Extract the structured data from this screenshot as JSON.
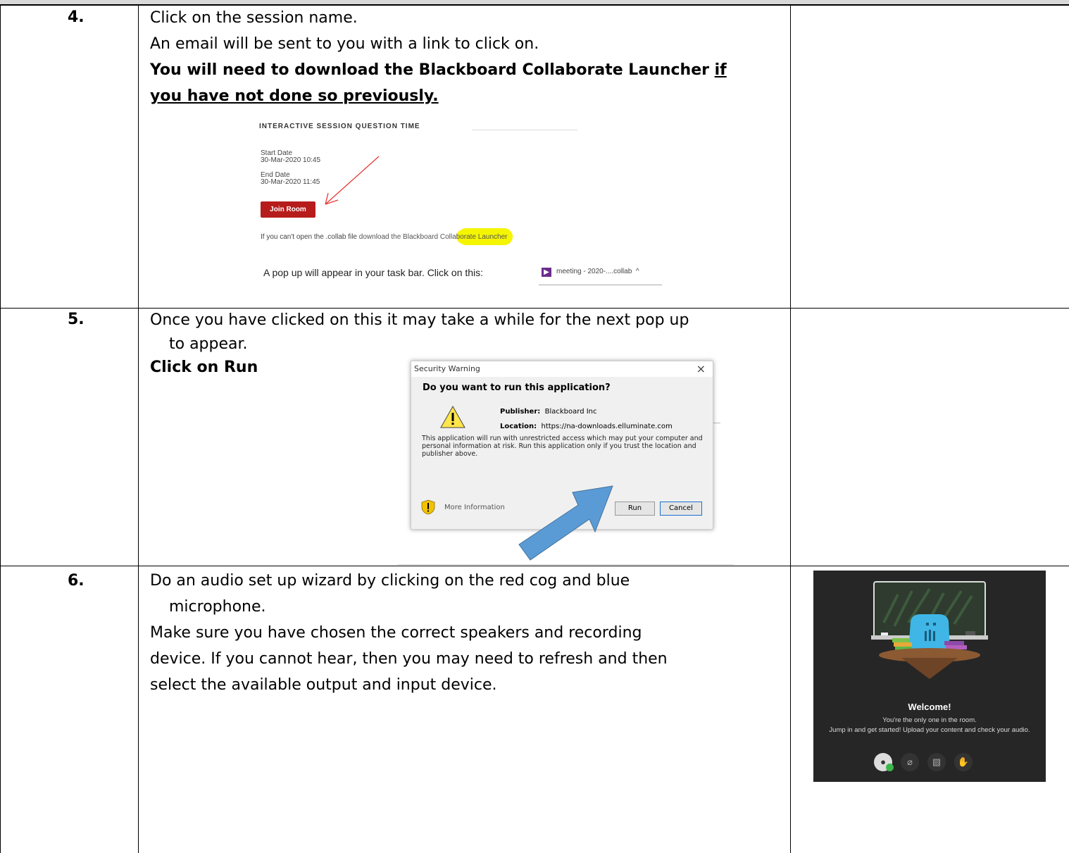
{
  "row4": {
    "number": "4.",
    "line1": "Click on the session name.",
    "line2": "An email will be sent to you with a link to click on.",
    "bold_line1_a": "You will need to download the Blackboard Collaborate Launcher ",
    "bold_line1_b": "if",
    "bold_line2": "you have not done so previously.",
    "email": {
      "title": "INTERACTIVE SESSION QUESTION TIME",
      "start_label": "Start Date",
      "start_value": "30-Mar-2020 10:45",
      "end_label": "End Date",
      "end_value": "30-Mar-2020 11:45",
      "join_button": "Join Room",
      "cant_open": "If you can't open the .collab file ",
      "download_link": "download the Blackboard Collaborate Launcher"
    },
    "popup_text": "A pop up will appear in your task bar. Click on this:",
    "taskbar_item": "meeting - 2020-....collab",
    "taskbar_chevron": "^"
  },
  "row5": {
    "number": "5.",
    "line1": "Once you have clicked on this it may take a while for the next pop up",
    "line2": "to appear.",
    "bold_line": "Click on Run",
    "dialog": {
      "title": "Security Warning",
      "close": "×",
      "question": "Do you want to run this application?",
      "publisher_label": "Publisher:",
      "publisher_value": "Blackboard Inc",
      "location_label": "Location:",
      "location_value": "https://na-downloads.elluminate.com",
      "warning_text": "This application will run with unrestricted access which may put your computer and personal information at risk. Run this application only if you trust the location and publisher above.",
      "more_info": "More Information",
      "run_button": "Run",
      "cancel_button": "Cancel"
    }
  },
  "row6": {
    "number": "6.",
    "line1": "Do an audio set up wizard by clicking on the red cog and blue",
    "line2": "microphone.",
    "line3": "Make sure you have chosen the correct speakers and recording",
    "line4": "device.  If you cannot hear, then you may need to refresh and then",
    "line5": "select the available output and input device.",
    "welcome": {
      "title": "Welcome!",
      "sub1": "You're the only one in the room.",
      "sub2": "Jump in and get started! Upload your content and check your audio."
    }
  },
  "colors": {
    "join_red": "#b71c1c",
    "highlight_yellow": "#f5f500",
    "arrow_blue": "#5b9bd5",
    "dark_panel": "#262626"
  }
}
